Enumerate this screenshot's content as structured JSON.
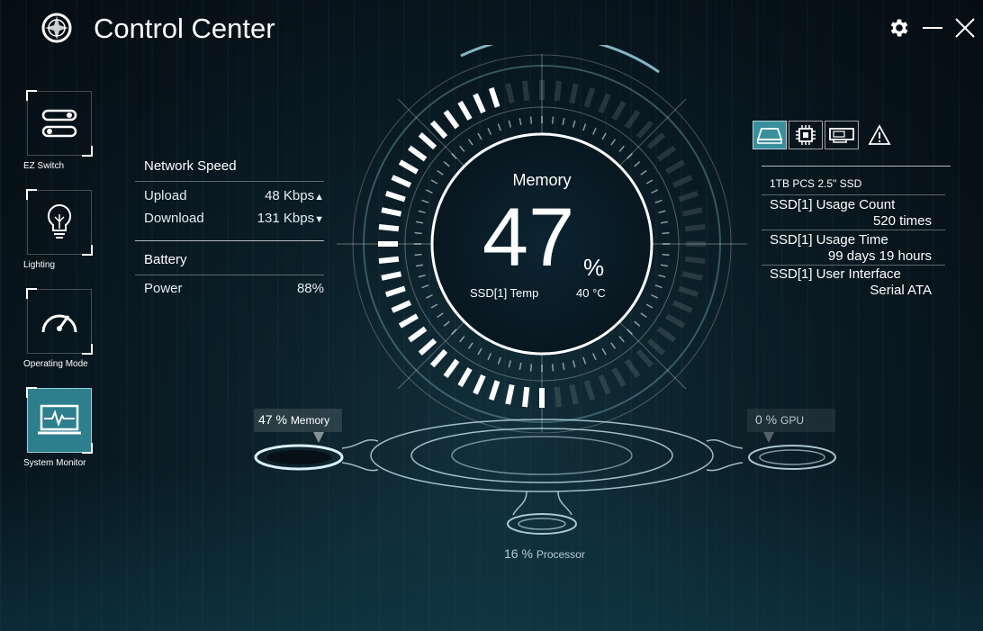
{
  "app": {
    "title": "Control Center"
  },
  "sidebar": {
    "items": [
      {
        "label": "EZ Switch",
        "icon": "toggle-switches-icon"
      },
      {
        "label": "Lighting",
        "icon": "lightbulb-icon"
      },
      {
        "label": "Operating Mode",
        "icon": "speedometer-icon"
      },
      {
        "label": "System Monitor",
        "icon": "monitor-pulse-icon"
      }
    ]
  },
  "network": {
    "heading": "Network Speed",
    "upload_label": "Upload",
    "upload_value": "48 Kbps",
    "download_label": "Download",
    "download_value": "131 Kbps"
  },
  "battery": {
    "heading": "Battery",
    "power_label": "Power",
    "power_value": "88%"
  },
  "gauge": {
    "title": "Memory",
    "value": "47",
    "unit": "%",
    "fill_percent": 47,
    "sub_label": "SSD[1] Temp",
    "sub_value": "40 °C"
  },
  "device_tabs": [
    {
      "icon": "ssd-icon",
      "active": true
    },
    {
      "icon": "cpu-chip-icon",
      "active": false
    },
    {
      "icon": "graphics-card-icon",
      "active": false
    },
    {
      "icon": "warning-icon",
      "active": false
    }
  ],
  "storage": {
    "device_name": "1TB PCS 2.5\" SSD",
    "usage_count_label": "SSD[1] Usage Count",
    "usage_count_value": "520 times",
    "usage_time_label": "SSD[1] Usage Time",
    "usage_time_value": "99 days 19 hours",
    "interface_label": "SSD[1] User Interface",
    "interface_value": "Serial ATA"
  },
  "nodes": {
    "memory_value": "47 %",
    "memory_label": "Memory",
    "gpu_value": "0 %",
    "gpu_label": "GPU",
    "processor_value": "16 %",
    "processor_label": "Processor"
  },
  "colors": {
    "accent": "#3a8f9c",
    "glow": "#9fe0ec"
  }
}
